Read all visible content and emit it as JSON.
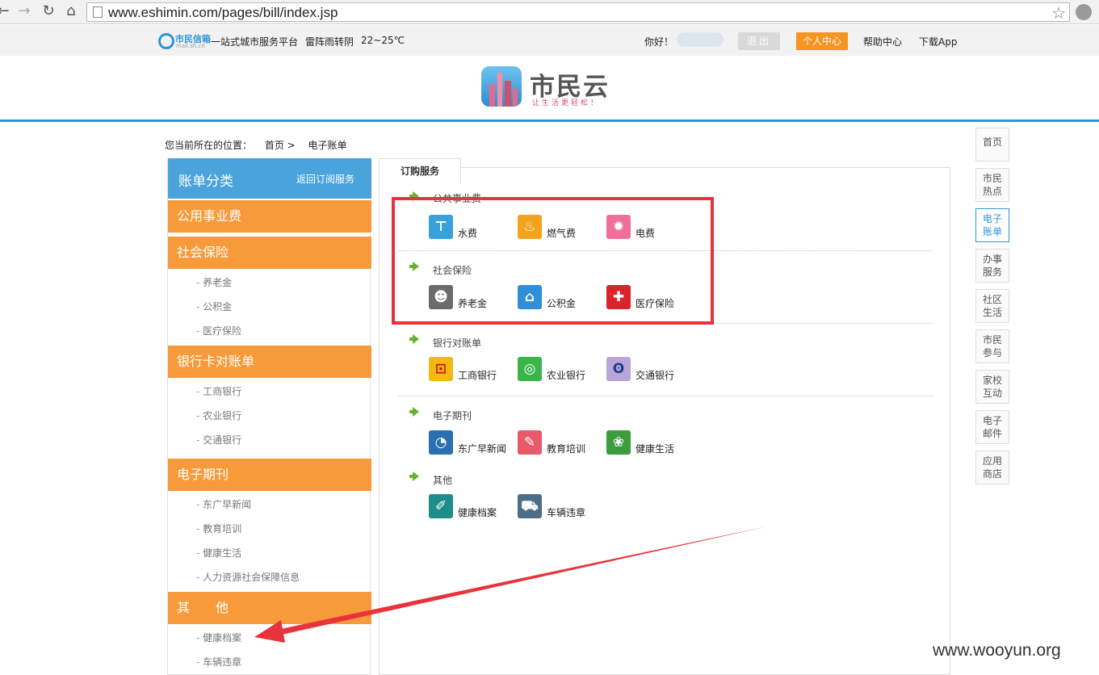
{
  "browser": {
    "url": "www.eshimin.com/pages/bill/index.jsp",
    "back_icon": "back-arrow-icon",
    "forward_icon": "forward-arrow-icon",
    "reload_icon": "reload-icon",
    "home_icon": "home-icon",
    "bookmark_icon": "star-icon"
  },
  "topbar": {
    "logo_text": "市民信箱",
    "logo_sub": "mail.sh.cn",
    "slogan": "一站式城市服务平台",
    "weather": "雷阵雨转阴",
    "temperature": "22~25℃",
    "greeting": "你好！",
    "logout": "退出",
    "user_center": "个人中心",
    "help": "帮助中心",
    "download": "下载App"
  },
  "brand": {
    "title": "市民云",
    "slogan": "让生活更轻松！"
  },
  "breadcrumb": {
    "label": "您当前所在的位置：",
    "home": "首页 >",
    "current": "电子账单"
  },
  "sidebar": {
    "title": "账单分类",
    "back_link": "返回订阅服务",
    "categories": [
      {
        "label": "公用事业费",
        "items": []
      },
      {
        "label": "社会保险",
        "items": [
          "养老金",
          "公积金",
          "医疗保险"
        ]
      },
      {
        "label": "银行卡对账单",
        "items": [
          "工商银行",
          "农业银行",
          "交通银行"
        ]
      },
      {
        "label": "电子期刊",
        "items": [
          "东广早新闻",
          "教育培训",
          "健康生活",
          "人力资源社会保障信息"
        ]
      },
      {
        "label": "其　　他",
        "items": [
          "健康档案",
          "车辆违章"
        ]
      }
    ]
  },
  "main": {
    "tab": "订购服务",
    "sections": [
      {
        "title": "公共事业费",
        "services": [
          {
            "label": "水费",
            "icon": "water-tap-icon",
            "color": "#3aa0dc"
          },
          {
            "label": "燃气费",
            "icon": "gas-flame-icon",
            "color": "#f5a21d"
          },
          {
            "label": "电费",
            "icon": "electricity-icon",
            "color": "#ef6f9a"
          }
        ]
      },
      {
        "title": "社会保险",
        "services": [
          {
            "label": "养老金",
            "icon": "elder-person-icon",
            "color": "#6b6b6b"
          },
          {
            "label": "公积金",
            "icon": "house-icon",
            "color": "#2f8fd8"
          },
          {
            "label": "医疗保险",
            "icon": "medical-cross-icon",
            "color": "#d9242c"
          }
        ]
      },
      {
        "title": "银行对账单",
        "services": [
          {
            "label": "工商银行",
            "icon": "icbc-logo-icon",
            "color": "#f2b90f"
          },
          {
            "label": "农业银行",
            "icon": "abc-logo-icon",
            "color": "#39b54a"
          },
          {
            "label": "交通银行",
            "icon": "bocom-logo-icon",
            "color": "#b9a5d6"
          }
        ]
      },
      {
        "title": "电子期刊",
        "services": [
          {
            "label": "东广早新闻",
            "icon": "radio-news-icon",
            "color": "#2a6fb0"
          },
          {
            "label": "教育培训",
            "icon": "education-icon",
            "color": "#e85a6a"
          },
          {
            "label": "健康生活",
            "icon": "health-life-icon",
            "color": "#3c9b3c"
          }
        ]
      },
      {
        "title": "其他",
        "services": [
          {
            "label": "健康档案",
            "icon": "health-record-icon",
            "color": "#1e8e8a"
          },
          {
            "label": "车辆违章",
            "icon": "car-icon",
            "color": "#4e6d88"
          }
        ]
      }
    ]
  },
  "right_nav": [
    {
      "label": "首页",
      "active": false
    },
    {
      "label": "市民热点",
      "active": false
    },
    {
      "label": "电子账单",
      "active": true
    },
    {
      "label": "办事服务",
      "active": false
    },
    {
      "label": "社区生活",
      "active": false
    },
    {
      "label": "市民参与",
      "active": false
    },
    {
      "label": "家校互动",
      "active": false
    },
    {
      "label": "电子邮件",
      "active": false
    },
    {
      "label": "应用商店",
      "active": false
    }
  ],
  "annotation": {
    "highlight_color": "#e8323c",
    "watermark": "www.wooyun.org"
  }
}
